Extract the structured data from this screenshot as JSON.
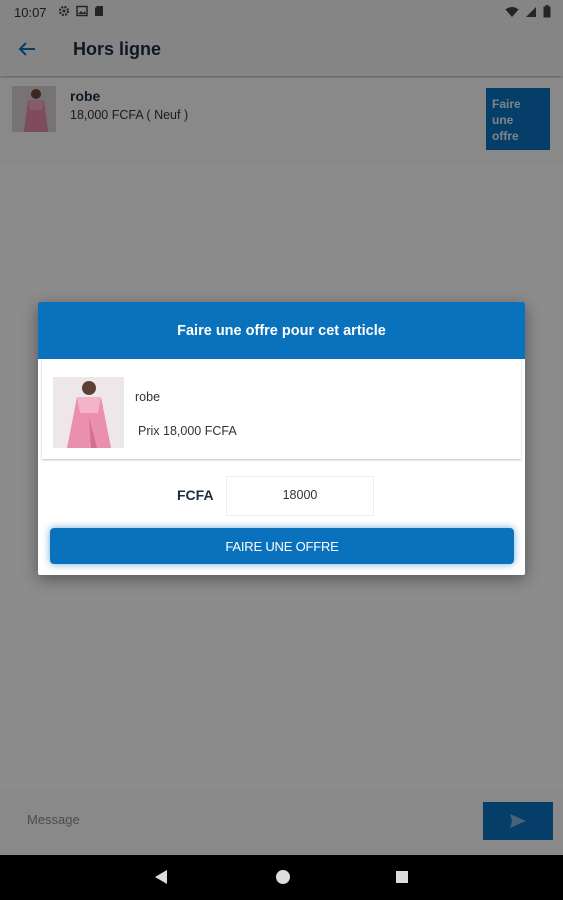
{
  "status_bar": {
    "time": "10:07",
    "left_icons": [
      "gear-icon",
      "image-icon",
      "sd-card-icon"
    ],
    "right_icons": [
      "wifi-icon",
      "signal-icon",
      "battery-icon"
    ]
  },
  "app_bar": {
    "title": "Hors ligne",
    "back_icon": "arrow-left-icon"
  },
  "product": {
    "name": "robe",
    "price_line": "18,000 FCFA ( Neuf )",
    "offer_button_label": "Faire\nune\noffre"
  },
  "message_bar": {
    "placeholder": "Message",
    "send_icon": "send-icon"
  },
  "nav_bar": {
    "icons": [
      "back-triangle-icon",
      "home-circle-icon",
      "recents-square-icon"
    ]
  },
  "dialog": {
    "title": "Faire une offre pour cet article",
    "item_name": "robe",
    "item_price": "Prix 18,000 FCFA",
    "currency_label": "FCFA",
    "amount_value": "18000",
    "submit_label": "FAIRE UNE OFFRE"
  },
  "colors": {
    "accent": "#0a72bd",
    "overlay": "rgba(0,0,0,0.45)"
  }
}
